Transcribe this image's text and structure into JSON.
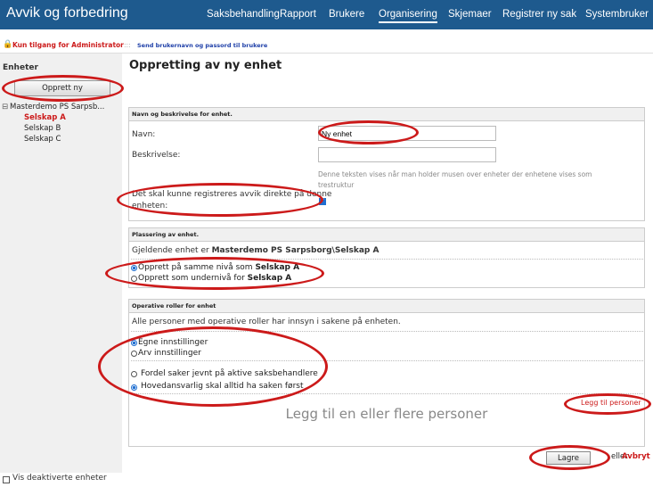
{
  "app_title": "Avvik og forbedring",
  "nav": [
    {
      "label": "Saksbehandling"
    },
    {
      "label": "Rapport"
    },
    {
      "label": "Brukere"
    },
    {
      "label": "Organisering",
      "active": true
    },
    {
      "label": "Skjemaer"
    },
    {
      "label": "Registrer ny sak"
    },
    {
      "label": "Systembruker"
    }
  ],
  "subbar": {
    "admin_text": "Kun tilgang for Administrator",
    "separator": ":::",
    "send_link": "Send brukernavn og passord til brukere"
  },
  "left": {
    "title": "Enheter",
    "create_button": "Opprett ny",
    "tree_root": "Masterdemo PS Sarpsb...",
    "tree_items": [
      "Selskap A",
      "Selskap B",
      "Selskap C"
    ]
  },
  "main": {
    "title": "Oppretting av ny enhet",
    "section1": {
      "head": "Navn og beskrivelse for enhet.",
      "name_label": "Navn:",
      "name_value": "Ny enhet",
      "desc_label": "Beskrivelse:",
      "desc_value": "",
      "hint_line1": "Denne teksten vises når man holder musen over enheter der enhetene vises som",
      "hint_line2": "trestruktur",
      "register_label_1": "Det skal kunne registreres avvik direkte på denne",
      "register_label_2": "enheten:",
      "register_checked": true
    },
    "section2": {
      "head": "Plassering av enhet.",
      "current_prefix": "Gjeldende enhet er ",
      "current_path": "Masterdemo PS Sarpsborg\\Selskap A",
      "opt1_prefix": "Opprett på samme nivå som ",
      "opt1_bold": "Selskap A",
      "opt2_prefix": "Opprett som undernivå for ",
      "opt2_bold": "Selskap A"
    },
    "section3": {
      "head": "Operative roller for enhet",
      "info": "Alle personer med operative roller har innsyn i sakene på enheten.",
      "opt_own": "Egne innstillinger",
      "opt_inherit": "Arv innstillinger",
      "opt_distribute": "Fordel saker jevnt på aktive saksbehandlere",
      "opt_main": "Hovedansvarlig skal alltid ha saken først",
      "add_link": "Legg til personer",
      "add_hint": "Legg til en eller flere personer"
    },
    "save_button": "Lagre",
    "or_text": "eller",
    "cancel_link": "Avbryt"
  },
  "bottom": {
    "show_inactive_label": "Vis deaktiverte enheter"
  },
  "colors": {
    "topbar": "#1e5a8e",
    "accent_red": "#cc1a1a",
    "link_blue": "#1e3fa8"
  }
}
